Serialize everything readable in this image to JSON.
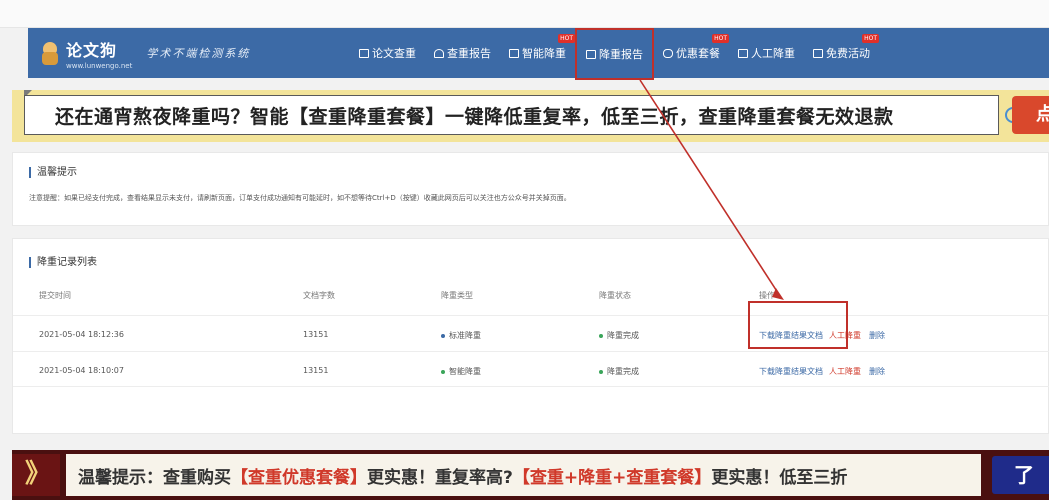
{
  "brand": {
    "name": "论文狗",
    "url": "www.lunwengo.net",
    "slogan": "学术不端检测系统"
  },
  "nav": [
    {
      "label": "论文查重",
      "icon": "document-icon",
      "hot": false
    },
    {
      "label": "查重报告",
      "icon": "user-report-icon",
      "hot": false
    },
    {
      "label": "智能降重",
      "icon": "document-icon",
      "hot": true
    },
    {
      "label": "降重报告",
      "icon": "document-icon",
      "hot": false,
      "active": true
    },
    {
      "label": "优惠套餐",
      "icon": "chat-icon",
      "hot": true
    },
    {
      "label": "人工降重",
      "icon": "document-icon",
      "hot": false
    },
    {
      "label": "免费活动",
      "icon": "document-icon",
      "hot": true
    }
  ],
  "hot_badge": "HOT",
  "promo_top": {
    "text": "还在通宵熬夜降重吗？智能【查重降重套餐】一键降低重复率，低至三折，查重降重套餐无效退款",
    "button": "点"
  },
  "tip": {
    "title": "温馨提示",
    "text": "注意提醒：如果已经支付完成，查看结果显示未支付，请刷新页面，订单支付成功通知有可能延时，如不想等待Ctrl+D（按键）收藏此网页后可以关注也方公众号并关掉页面。"
  },
  "records": {
    "title": "降重记录列表",
    "columns": [
      "提交时间",
      "文档字数",
      "降重类型",
      "降重状态",
      "操作"
    ],
    "rows": [
      {
        "time": "2021-05-04 18:12:36",
        "words": "13151",
        "type": "标准降重",
        "status": "降重完成",
        "download": "下载降重结果文档",
        "manual": "人工降重",
        "delete": "删除"
      },
      {
        "time": "2021-05-04 18:10:07",
        "words": "13151",
        "type": "智能降重",
        "status": "降重完成",
        "download": "下载降重结果文档",
        "manual": "人工降重",
        "delete": "删除"
      }
    ]
  },
  "promo_bottom": {
    "prefix": "温馨提示：查重购买",
    "red1": "【查重优惠套餐】",
    "mid1": "更实惠！重复率高?",
    "red2": "【查重+降重+查重套餐】",
    "mid2": "更实惠！低至三折",
    "icon": "》",
    "button": "了解"
  },
  "colors": {
    "header": "#3c6aa6",
    "accent_red": "#c0302a",
    "promo_yellow": "#f3e49a"
  }
}
